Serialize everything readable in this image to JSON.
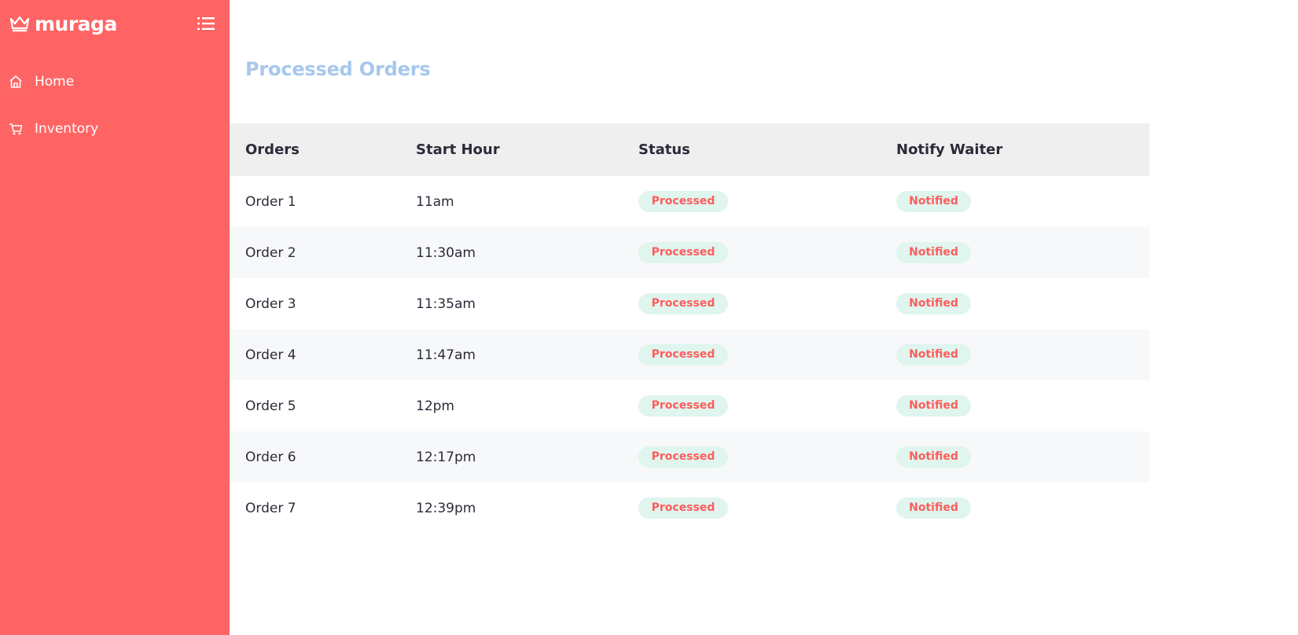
{
  "brand": {
    "name": "muraga",
    "icon": "crown-icon"
  },
  "sidebar": {
    "toggle_icon": "list-menu-icon",
    "items": [
      {
        "label": "Home",
        "icon": "home-icon"
      },
      {
        "label": "Inventory",
        "icon": "cart-icon"
      }
    ]
  },
  "main": {
    "title": "Processed Orders",
    "table": {
      "headers": [
        "Orders",
        "Start Hour",
        "Status",
        "Notify Waiter"
      ],
      "rows": [
        {
          "order": "Order 1",
          "start": "11am",
          "status": "Processed",
          "notify": "Notified"
        },
        {
          "order": "Order 2",
          "start": "11:30am",
          "status": "Processed",
          "notify": "Notified"
        },
        {
          "order": "Order 3",
          "start": "11:35am",
          "status": "Processed",
          "notify": "Notified"
        },
        {
          "order": "Order 4",
          "start": "11:47am",
          "status": "Processed",
          "notify": "Notified"
        },
        {
          "order": "Order 5",
          "start": "12pm",
          "status": "Processed",
          "notify": "Notified"
        },
        {
          "order": "Order 6",
          "start": "12:17pm",
          "status": "Processed",
          "notify": "Notified"
        },
        {
          "order": "Order 7",
          "start": "12:39pm",
          "status": "Processed",
          "notify": "Notified"
        }
      ]
    }
  },
  "colors": {
    "sidebar": "#ff6464",
    "title": "#a7c7ec",
    "badge_bg": "#dff5ee",
    "badge_text": "#ff5c5c",
    "header_bg": "#efefef",
    "stripe": "#f7f8fa"
  }
}
